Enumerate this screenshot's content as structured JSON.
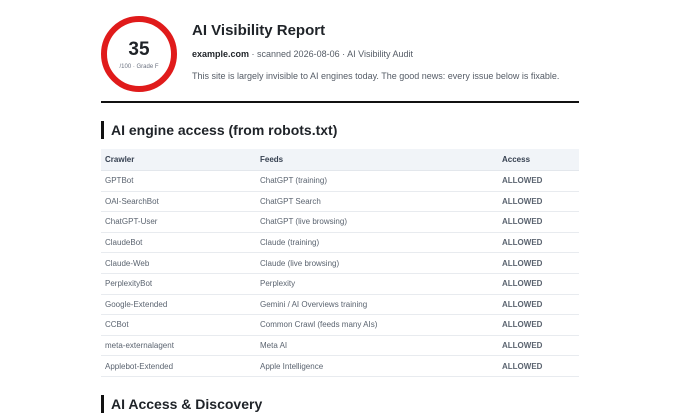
{
  "score": {
    "value": "35",
    "sub": "/100 · Grade F"
  },
  "report": {
    "title": "AI Visibility Report",
    "domain": "example.com",
    "meta": " · scanned 2026-08-06 · AI Visibility Audit",
    "summary": "This site is largely invisible to AI engines today. The good news: every issue below is fixable."
  },
  "colors": {
    "ring": "#e01b1b",
    "allowed": "#22a03a"
  },
  "engine_access": {
    "title": "AI engine access (from robots.txt)",
    "headers": {
      "crawler": "Crawler",
      "feeds": "Feeds",
      "access": "Access"
    },
    "rows": [
      {
        "crawler": "GPTBot",
        "feeds": "ChatGPT (training)",
        "access": "ALLOWED"
      },
      {
        "crawler": "OAI-SearchBot",
        "feeds": "ChatGPT Search",
        "access": "ALLOWED"
      },
      {
        "crawler": "ChatGPT-User",
        "feeds": "ChatGPT (live browsing)",
        "access": "ALLOWED"
      },
      {
        "crawler": "ClaudeBot",
        "feeds": "Claude (training)",
        "access": "ALLOWED"
      },
      {
        "crawler": "Claude-Web",
        "feeds": "Claude (live browsing)",
        "access": "ALLOWED"
      },
      {
        "crawler": "PerplexityBot",
        "feeds": "Perplexity",
        "access": "ALLOWED"
      },
      {
        "crawler": "Google-Extended",
        "feeds": "Gemini / AI Overviews training",
        "access": "ALLOWED"
      },
      {
        "crawler": "CCBot",
        "feeds": "Common Crawl (feeds many AIs)",
        "access": "ALLOWED"
      },
      {
        "crawler": "meta-externalagent",
        "feeds": "Meta AI",
        "access": "ALLOWED"
      },
      {
        "crawler": "Applebot-Extended",
        "feeds": "Apple Intelligence",
        "access": "ALLOWED"
      }
    ]
  },
  "discovery": {
    "title": "AI Access & Discovery"
  }
}
